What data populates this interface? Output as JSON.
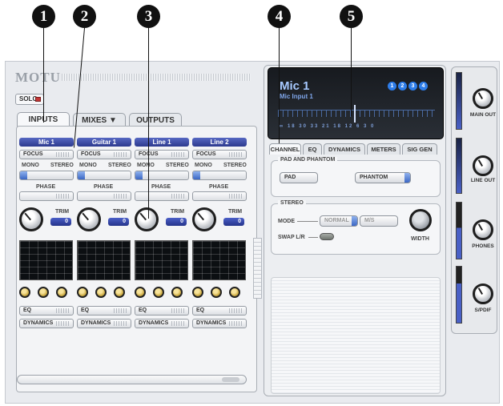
{
  "callouts": [
    "1",
    "2",
    "3",
    "4",
    "5"
  ],
  "app": {
    "brand": "MOTU",
    "solo_label": "SOLO",
    "tabs": {
      "inputs": "INPUTS",
      "mixes": "MIXES ▼",
      "outputs": "OUTPUTS"
    }
  },
  "channels": [
    {
      "name": "Mic 1",
      "focus": "FOCUS",
      "mono": "MONO",
      "stereo": "STEREO",
      "phase": "PHASE",
      "trim": "TRIM",
      "trim_value": "0",
      "eq": "EQ",
      "dynamics": "DYNAMICS"
    },
    {
      "name": "Guitar 1",
      "focus": "FOCUS",
      "mono": "MONO",
      "stereo": "STEREO",
      "phase": "PHASE",
      "trim": "TRIM",
      "trim_value": "0",
      "eq": "EQ",
      "dynamics": "DYNAMICS"
    },
    {
      "name": "Line 1",
      "focus": "FOCUS",
      "mono": "MONO",
      "stereo": "STEREO",
      "phase": "PHASE",
      "trim": "TRIM",
      "trim_value": "0",
      "eq": "EQ",
      "dynamics": "DYNAMICS"
    },
    {
      "name": "Line 2",
      "focus": "FOCUS",
      "mono": "MONO",
      "stereo": "STEREO",
      "phase": "PHASE",
      "trim": "TRIM",
      "trim_value": "0",
      "eq": "EQ",
      "dynamics": "DYNAMICS"
    }
  ],
  "lcd": {
    "title": "Mic 1",
    "subtitle": "Mic Input 1",
    "badges": [
      "1",
      "2",
      "3",
      "4"
    ],
    "scale": "∞  18  30  33  21   18      12          6       3       0"
  },
  "right_tabs": [
    "CHANNEL",
    "EQ",
    "DYNAMICS",
    "METERS",
    "SIG GEN"
  ],
  "pad_phantom": {
    "title": "PAD AND PHANTOM",
    "pad": "PAD",
    "phantom": "PHANTOM"
  },
  "stereo": {
    "title": "STEREO",
    "mode": "MODE",
    "normal": "NORMAL",
    "ms": "M/S",
    "swap": "SWAP L/R",
    "width": "WIDTH"
  },
  "outputs": [
    "MAIN OUT",
    "LINE OUT",
    "PHONES",
    "S/PDIF"
  ],
  "colors": {
    "accent_blue": "#2c3a8e",
    "led_red": "#c43636"
  }
}
